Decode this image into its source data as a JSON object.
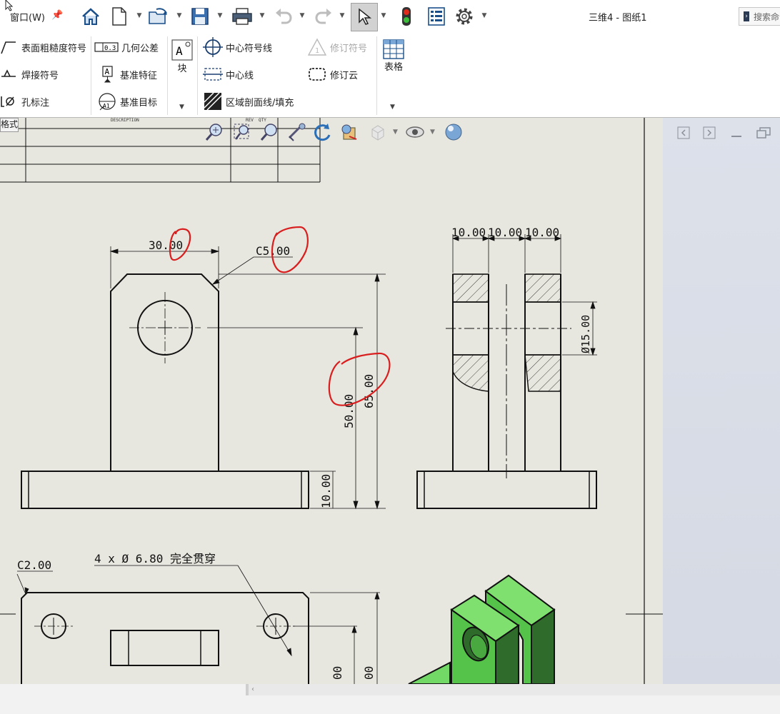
{
  "window": {
    "menu_label": "窗口(W)",
    "document_title": "三维4 - 图纸1",
    "search_placeholder": "搜索命令"
  },
  "toolbar": {
    "buttons": [
      "home-icon",
      "new-document-icon",
      "open-icon",
      "save-icon",
      "print-icon",
      "undo-icon",
      "redo-icon",
      "select-pointer-icon",
      "traffic-light-icon",
      "file-properties-icon",
      "gear-icon"
    ]
  },
  "ribbon": {
    "annotation_group": [
      {
        "label": "表面粗糙度符号",
        "icon": "surface-finish-icon"
      },
      {
        "label": "焊接符号",
        "icon": "weld-symbol-icon"
      },
      {
        "label": "孔标注",
        "icon": "hole-callout-icon"
      }
    ],
    "tolerance_group": [
      {
        "label": "几何公差",
        "icon": "geometric-tolerance-icon",
        "icon_text": "0.3"
      },
      {
        "label": "基准特征",
        "icon": "datum-feature-icon",
        "icon_text": "A"
      },
      {
        "label": "基准目标",
        "icon": "datum-target-icon",
        "icon_text": "A1"
      }
    ],
    "block": {
      "label": "块",
      "icon_text": "A"
    },
    "centerline_group": [
      {
        "label": "中心符号线",
        "icon": "center-mark-icon"
      },
      {
        "label": "中心线",
        "icon": "centerline-icon"
      },
      {
        "label": "区域剖面线/填充",
        "icon": "hatch-fill-icon"
      }
    ],
    "revision_group": [
      {
        "label": "修订符号",
        "icon": "revision-symbol-icon",
        "disabled": true,
        "icon_text": "1"
      },
      {
        "label": "修订云",
        "icon": "revision-cloud-icon",
        "disabled": false
      }
    ],
    "table": {
      "label": "表格"
    }
  },
  "sheet": {
    "tab_label": "格式",
    "title_block_headers": [
      "DESCRIPTION",
      "REV",
      "QTY"
    ]
  },
  "drawing": {
    "dimensions": {
      "top_width": "30.00",
      "chamfer_top": "C5.00",
      "height_total": "65.00",
      "height_hole": "50.00",
      "base_height": "10.00",
      "side_width_1": "10.00",
      "side_width_2": "10.00",
      "side_width_3": "10.00",
      "bore_dia": "Ø15.00",
      "chamfer_base": "C2.00",
      "hole_note": "4 x  Ø  6.80  完全贯穿",
      "partial_1": "00",
      "partial_2": "00"
    },
    "colors": {
      "markup": "#d81e1e",
      "model_green": "#55c24a",
      "paper": "#e8e7df",
      "line": "#111111"
    }
  }
}
